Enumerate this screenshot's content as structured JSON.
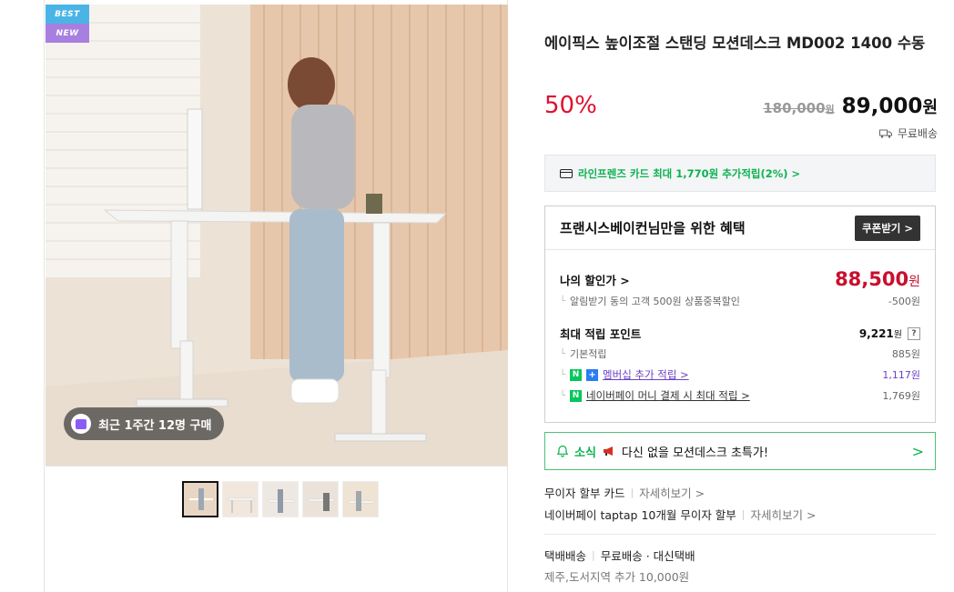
{
  "badges": {
    "best": "BEST",
    "new": "NEW"
  },
  "purchase_chip": "최근 1주간 12명 구매",
  "product": {
    "title": "에이픽스 높이조절 스탠딩 모션데스크 MD002 1400 수동",
    "discount": "50%",
    "original_price": "180,000",
    "original_unit": "원",
    "sale_price": "89,000",
    "sale_unit": "원",
    "shipping": "무료배송"
  },
  "card_benefit": "라인프렌즈 카드 최대 1,770원 추가적립(2%) >",
  "benefit_box": {
    "title": "프랜시스베이컨님만을 위한 혜택",
    "coupon_button": "쿠폰받기 >",
    "my_discount_label": "나의 할인가 >",
    "my_discount_price": "88,500",
    "my_discount_unit": "원",
    "alarm_label": "알림받기 동의 고객 500원 상품중복할인",
    "alarm_value": "-500원",
    "max_point_label": "최대 적립 포인트",
    "max_point_value": "9,221",
    "max_point_unit": "원",
    "help": "?",
    "basic_label": "기본적립",
    "basic_value": "885원",
    "membership_label": "멤버십 추가 적립 >",
    "membership_value": "1,117원",
    "npay_label": "네이버페이 머니 결제 시 최대 적립 >",
    "npay_value": "1,769원",
    "n_glyph": "N",
    "plus_glyph": "+"
  },
  "news_bar": {
    "label": "소식",
    "text": "다신 없을 모션데스크 초특가!",
    "chevron": ">"
  },
  "installment": {
    "line1_label": "무이자 할부 카드",
    "line1_more": "자세히보기 >",
    "line2_label": "네이버페이 taptap 10개월 무이자 할부",
    "line2_more": "자세히보기 >"
  },
  "delivery": {
    "type": "택배배송",
    "fee": "무료배송 · 대신택배",
    "extra": "제주,도서지역 추가 10,000원"
  },
  "colors": {
    "accent_red": "#e0102f",
    "naver_green": "#03c75a",
    "purple": "#6a3fc9"
  }
}
